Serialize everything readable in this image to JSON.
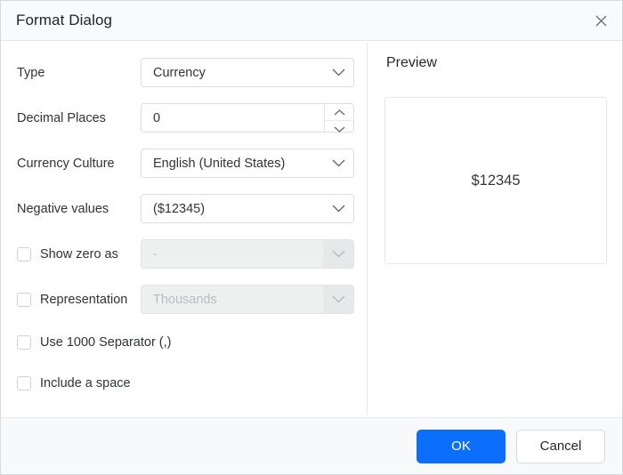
{
  "dialog": {
    "title": "Format Dialog",
    "close_icon": "close-icon"
  },
  "form": {
    "rows": [
      {
        "label": "Type",
        "value": "Currency",
        "control": "dropdown"
      },
      {
        "label": "Decimal Places",
        "value": "0",
        "control": "spinner"
      },
      {
        "label": "Currency Culture",
        "value": "English (United States)",
        "control": "dropdown"
      },
      {
        "label": "Negative values",
        "value": "($12345)",
        "control": "dropdown"
      }
    ],
    "checkbox_rows": [
      {
        "label": "Show zero as",
        "value": "-",
        "checked": false,
        "disabled": true
      },
      {
        "label": "Representation",
        "value": "Thousands",
        "checked": false,
        "disabled": true
      }
    ],
    "checkboxes": [
      {
        "label": "Use 1000 Separator (,)",
        "checked": false
      },
      {
        "label": "Include a space",
        "checked": false
      }
    ]
  },
  "preview": {
    "title": "Preview",
    "value": "$12345"
  },
  "footer": {
    "ok_label": "OK",
    "cancel_label": "Cancel"
  },
  "colors": {
    "accent": "#0b6ffb",
    "titlebar_bg": "#f9fafb",
    "footer_bg": "#f8f9fa",
    "border": "#dcdee1",
    "disabled_bg": "#eeefef",
    "text": "#303338"
  }
}
